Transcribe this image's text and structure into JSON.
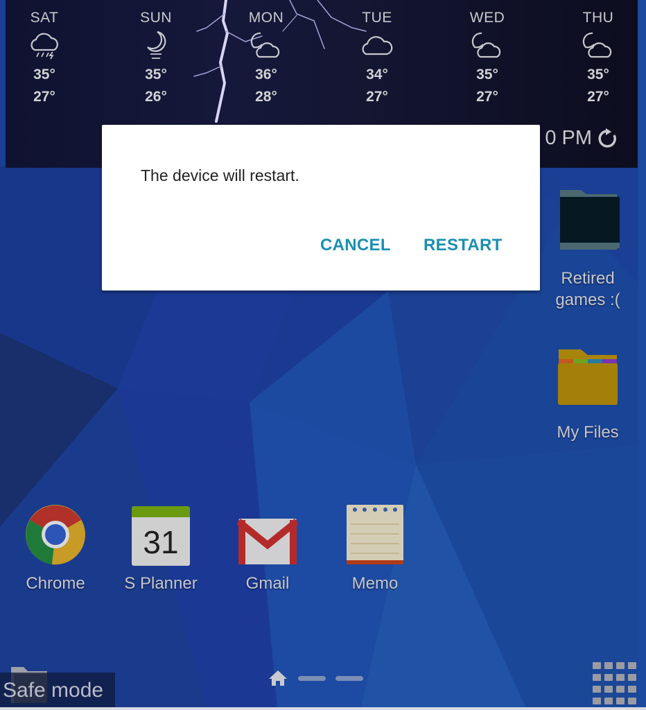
{
  "weather": {
    "forecast": [
      {
        "day": "SAT",
        "icon": "thunderstorm-icon",
        "high": "35°",
        "low": "27°"
      },
      {
        "day": "SUN",
        "icon": "moon-fog-icon",
        "high": "35°",
        "low": "26°"
      },
      {
        "day": "MON",
        "icon": "partly-cloudy-night-icon",
        "high": "36°",
        "low": "28°"
      },
      {
        "day": "TUE",
        "icon": "cloud-icon",
        "high": "34°",
        "low": "27°"
      },
      {
        "day": "WED",
        "icon": "partly-cloudy-night-icon",
        "high": "35°",
        "low": "27°"
      },
      {
        "day": "THU",
        "icon": "partly-cloudy-night-icon",
        "high": "35°",
        "low": "27°"
      }
    ],
    "updated_time": "0 PM"
  },
  "dialog": {
    "message": "The device will restart.",
    "cancel_label": "CANCEL",
    "restart_label": "RESTART",
    "accent_color": "#1a8fb0"
  },
  "desktop": {
    "folders": [
      {
        "label": "Retired games :(",
        "icon": "folder-dark-icon"
      },
      {
        "label": "My Files",
        "icon": "my-files-folder-icon"
      }
    ],
    "apps": [
      {
        "label": "Chrome",
        "icon": "chrome-icon"
      },
      {
        "label": "S Planner",
        "icon": "calendar-icon",
        "icon_text": "31"
      },
      {
        "label": "Gmail",
        "icon": "gmail-icon"
      },
      {
        "label": "Memo",
        "icon": "memo-icon"
      }
    ]
  },
  "status": {
    "safe_mode_label": "Safe mode"
  }
}
